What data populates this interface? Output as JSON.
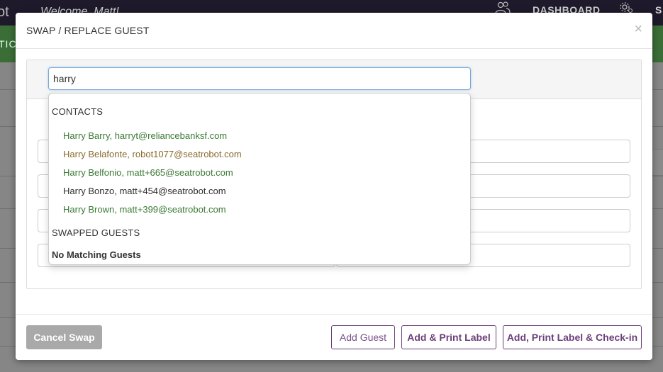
{
  "background": {
    "logo_fragment": "ot",
    "welcome": "Welcome, Matt!",
    "dashboard_label": "DASHBOARD",
    "s_fragment": "S",
    "tick_fragment": "TICK"
  },
  "modal": {
    "title": "SWAP / REPLACE GUEST",
    "close_symbol": "×",
    "search": {
      "value": "harry"
    },
    "dropdown": {
      "contacts_heading": "CONTACTS",
      "contacts": [
        {
          "label": "Harry Barry, harryt@reliancebanksf.com",
          "color": "#3b7a34"
        },
        {
          "label": "Harry Belafonte, robot1077@seatrobot.com",
          "color": "#8a6a2a"
        },
        {
          "label": "Harry Belfonio, matt+665@seatrobot.com",
          "color": "#3b7a34"
        },
        {
          "label": "Harry Bonzo, matt+454@seatrobot.com",
          "color": "#2f2f2f"
        },
        {
          "label": "Harry Brown, matt+399@seatrobot.com",
          "color": "#3b7a34"
        }
      ],
      "swapped_heading": "SWAPPED GUESTS",
      "no_match": "No Matching Guests"
    },
    "footer": {
      "cancel_label": "Cancel Swap",
      "add_label": "Add Guest",
      "print_label": "Add & Print Label",
      "checkin_label": "Add, Print Label & Check-in"
    }
  },
  "colors": {
    "accent_purple": "#6b3f7a",
    "contact_green": "#3b7a34",
    "contact_orange": "#8a6a2a",
    "topbar": "#1f1a2b",
    "brand_green": "#3b6e36"
  }
}
